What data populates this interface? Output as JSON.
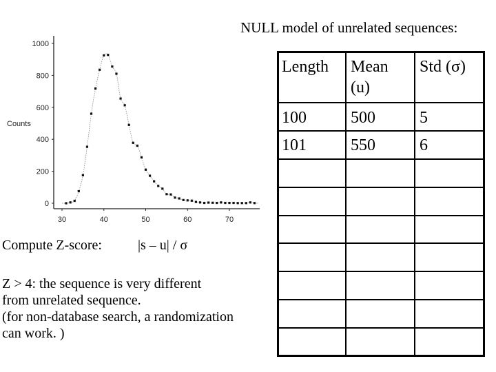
{
  "slide": {
    "title": "NULL model of unrelated sequences:",
    "zscore_label": "Compute Z-score:",
    "zscore_formula": "|s – u| /  σ",
    "notes": [
      "Z > 4: the sequence is very different",
      "from unrelated sequence.",
      "(for non-database search, a randomization",
      "can work. )"
    ]
  },
  "table": {
    "headers": [
      "Length",
      "Mean",
      "(u)",
      "Std (σ)"
    ],
    "rows": [
      [
        "100",
        "500",
        "5"
      ],
      [
        "101",
        "550",
        "6"
      ]
    ],
    "empty_rows": 7
  },
  "chart_data": {
    "type": "scatter",
    "title": "",
    "xlabel": "",
    "ylabel": "Counts",
    "xlim": [
      28,
      78
    ],
    "ylim": [
      0,
      1000
    ],
    "xticks": [
      30,
      40,
      50,
      60,
      70
    ],
    "yticks": [
      0,
      200,
      400,
      600,
      800,
      1000
    ],
    "grid": false,
    "legend": "none",
    "series": [
      {
        "name": "counts",
        "style": "points with dotted fitted curve",
        "x": [
          31,
          32,
          33,
          34,
          35,
          36,
          37,
          38,
          39,
          40,
          41,
          42,
          43,
          44,
          45,
          46,
          47,
          48,
          49,
          50,
          51,
          52,
          53,
          54,
          55,
          56,
          57,
          58,
          59,
          60,
          61,
          62,
          63,
          64,
          65,
          66,
          67,
          68,
          69,
          70,
          71,
          72,
          73,
          74,
          75,
          76
        ],
        "y": [
          0,
          5,
          15,
          75,
          175,
          353,
          560,
          718,
          835,
          925,
          928,
          855,
          810,
          655,
          613,
          490,
          378,
          360,
          287,
          210,
          172,
          137,
          108,
          91,
          57,
          55,
          35,
          30,
          20,
          18,
          16,
          8,
          5,
          2,
          4,
          3,
          2,
          5,
          2,
          2,
          2,
          1,
          1,
          1,
          5,
          1
        ]
      }
    ]
  }
}
